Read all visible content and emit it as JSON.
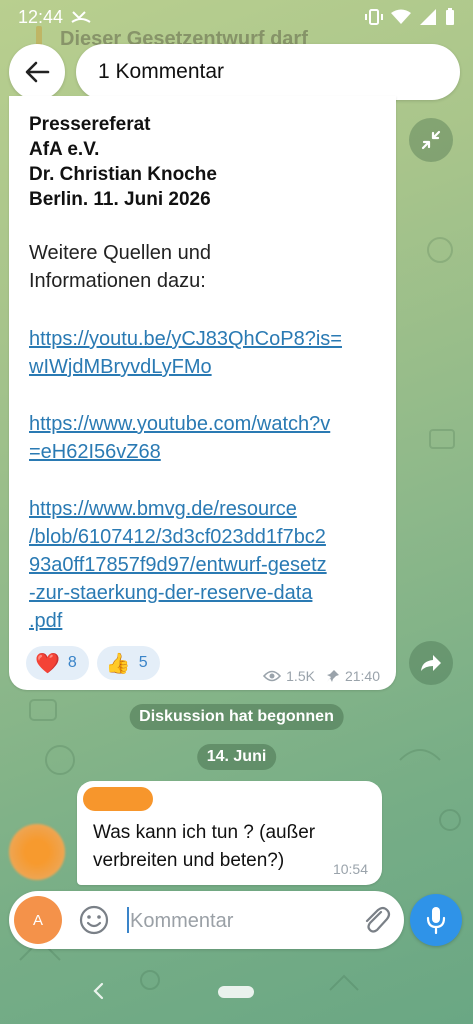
{
  "status_bar": {
    "time": "12:44"
  },
  "header": {
    "faded_pinned_text": "Dieser Gesetzentwurf darf",
    "title": "1 Kommentar"
  },
  "post": {
    "signature": [
      "Pressereferat",
      "AfA e.V.",
      "Dr. Christian Knoche",
      "Berlin. 11. Juni 2026"
    ],
    "sources_intro": [
      "Weitere Quellen und",
      "Informationen dazu:"
    ],
    "links": [
      [
        "https://youtu.be/yCJ83QhCoP8?is=",
        "wIWjdMBryvdLyFMo"
      ],
      [
        "https://www.youtube.com/watch?v",
        "=eH62I56vZ68"
      ],
      [
        "https://www.bmvg.de/resource",
        "/blob/6107412/3d3cf023dd1f7bc2",
        "93a0ff17857f9d97/entwurf-gesetz",
        "-zur-staerkung-der-reserve-data",
        ".pdf"
      ]
    ],
    "reactions": [
      {
        "emoji": "❤️",
        "count": "8",
        "icon": "heart-icon"
      },
      {
        "emoji": "👍",
        "count": "5",
        "icon": "thumbs-up-icon"
      }
    ],
    "views": "1.5K",
    "time": "21:40"
  },
  "service": {
    "discussion_started": "Diskussion hat begonnen",
    "date": "14. Juni"
  },
  "comment": {
    "text": [
      "Was kann ich tun ? (außer",
      "verbreiten und beten?)"
    ],
    "time": "10:54"
  },
  "input": {
    "avatar_letter": "A",
    "placeholder": "Kommentar"
  },
  "colors": {
    "link": "#2a7ab3",
    "accent": "#2f93e8",
    "reaction_bg": "#e4eef8"
  }
}
